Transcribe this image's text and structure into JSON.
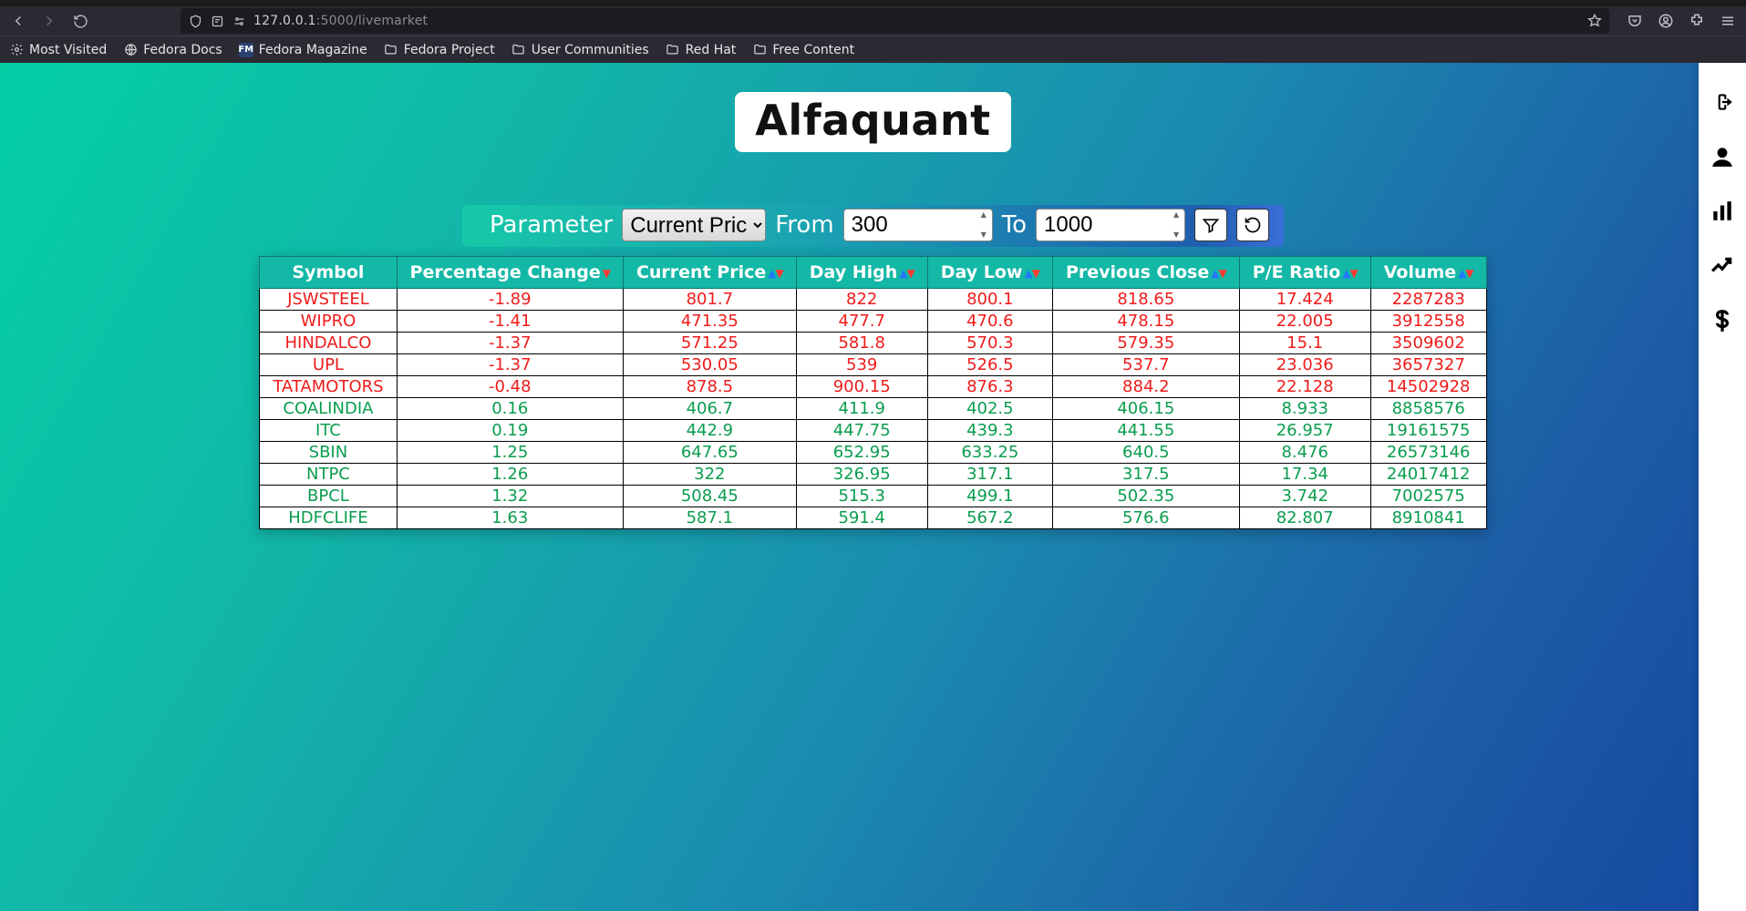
{
  "browser": {
    "url_host": "127.0.0.1",
    "url_path": ":5000/livemarket",
    "bookmarks": [
      {
        "label": "Most Visited",
        "icon": "gear"
      },
      {
        "label": "Fedora Docs",
        "icon": "globe"
      },
      {
        "label": "Fedora Magazine",
        "icon": "fm"
      },
      {
        "label": "Fedora Project",
        "icon": "folder"
      },
      {
        "label": "User Communities",
        "icon": "folder"
      },
      {
        "label": "Red Hat",
        "icon": "folder"
      },
      {
        "label": "Free Content",
        "icon": "folder"
      }
    ]
  },
  "app": {
    "title": "Alfaquant"
  },
  "filter": {
    "parameter_label": "Parameter",
    "parameter_value": "Current Price",
    "from_label": "From",
    "from_value": "300",
    "to_label": "To",
    "to_value": "1000"
  },
  "table": {
    "columns": [
      {
        "key": "symbol",
        "label": "Symbol",
        "sortable": false
      },
      {
        "key": "pct",
        "label": "Percentage Change",
        "sortable": true,
        "active_sort": "desc_only"
      },
      {
        "key": "price",
        "label": "Current Price",
        "sortable": true
      },
      {
        "key": "high",
        "label": "Day High",
        "sortable": true
      },
      {
        "key": "low",
        "label": "Day Low",
        "sortable": true
      },
      {
        "key": "prev",
        "label": "Previous Close",
        "sortable": true
      },
      {
        "key": "pe",
        "label": "P/E Ratio",
        "sortable": true
      },
      {
        "key": "vol",
        "label": "Volume",
        "sortable": true
      }
    ],
    "rows": [
      {
        "symbol": "JSWSTEEL",
        "pct": "-1.89",
        "price": "801.7",
        "high": "822",
        "low": "800.1",
        "prev": "818.65",
        "pe": "17.424",
        "vol": "2287283",
        "dir": "neg"
      },
      {
        "symbol": "WIPRO",
        "pct": "-1.41",
        "price": "471.35",
        "high": "477.7",
        "low": "470.6",
        "prev": "478.15",
        "pe": "22.005",
        "vol": "3912558",
        "dir": "neg"
      },
      {
        "symbol": "HINDALCO",
        "pct": "-1.37",
        "price": "571.25",
        "high": "581.8",
        "low": "570.3",
        "prev": "579.35",
        "pe": "15.1",
        "vol": "3509602",
        "dir": "neg"
      },
      {
        "symbol": "UPL",
        "pct": "-1.37",
        "price": "530.05",
        "high": "539",
        "low": "526.5",
        "prev": "537.7",
        "pe": "23.036",
        "vol": "3657327",
        "dir": "neg"
      },
      {
        "symbol": "TATAMOTORS",
        "pct": "-0.48",
        "price": "878.5",
        "high": "900.15",
        "low": "876.3",
        "prev": "884.2",
        "pe": "22.128",
        "vol": "14502928",
        "dir": "neg"
      },
      {
        "symbol": "COALINDIA",
        "pct": "0.16",
        "price": "406.7",
        "high": "411.9",
        "low": "402.5",
        "prev": "406.15",
        "pe": "8.933",
        "vol": "8858576",
        "dir": "pos"
      },
      {
        "symbol": "ITC",
        "pct": "0.19",
        "price": "442.9",
        "high": "447.75",
        "low": "439.3",
        "prev": "441.55",
        "pe": "26.957",
        "vol": "19161575",
        "dir": "pos"
      },
      {
        "symbol": "SBIN",
        "pct": "1.25",
        "price": "647.65",
        "high": "652.95",
        "low": "633.25",
        "prev": "640.5",
        "pe": "8.476",
        "vol": "26573146",
        "dir": "pos"
      },
      {
        "symbol": "NTPC",
        "pct": "1.26",
        "price": "322",
        "high": "326.95",
        "low": "317.1",
        "prev": "317.5",
        "pe": "17.34",
        "vol": "24017412",
        "dir": "pos"
      },
      {
        "symbol": "BPCL",
        "pct": "1.32",
        "price": "508.45",
        "high": "515.3",
        "low": "499.1",
        "prev": "502.35",
        "pe": "3.742",
        "vol": "7002575",
        "dir": "pos"
      },
      {
        "symbol": "HDFCLIFE",
        "pct": "1.63",
        "price": "587.1",
        "high": "591.4",
        "low": "567.2",
        "prev": "576.6",
        "pe": "82.807",
        "vol": "8910841",
        "dir": "pos"
      }
    ]
  },
  "sidebar": {
    "items": [
      {
        "name": "logout-icon"
      },
      {
        "name": "user-icon"
      },
      {
        "name": "bar-chart-icon"
      },
      {
        "name": "trend-icon"
      },
      {
        "name": "dollar-icon"
      }
    ]
  }
}
